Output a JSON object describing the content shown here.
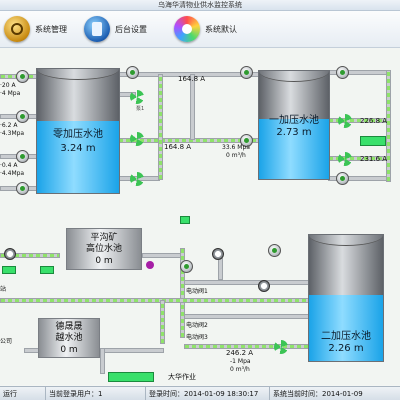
{
  "window": {
    "title": "乌海华清物业供水监控系统"
  },
  "toolbar": {
    "items": [
      {
        "label": "系统管理"
      },
      {
        "label": "后台设置"
      },
      {
        "label": "系统默认"
      }
    ]
  },
  "tanks": {
    "zero": {
      "name": "零加压水池",
      "value": "3.24 m"
    },
    "one": {
      "name": "一加压水池",
      "value": "2.73 m"
    },
    "two": {
      "name": "二加压水池",
      "value": "2.26 m"
    },
    "pinggou": {
      "name_line1": "平沟矿",
      "name_line2": "高位水池",
      "value": "0 m"
    },
    "desheng": {
      "name_line1": "德晟晟",
      "name_line2": "越水池",
      "value": "0 m"
    }
  },
  "readings": {
    "l1": "·20 A",
    "l2": "·4 Mpa",
    "l3": "·6.2 A",
    "l4": "·4.3Mpa",
    "l5": "·0.4 A",
    "l6": "·4.4Mpa",
    "c1": "164.8 A",
    "c2": "164.8 A",
    "c3": "33.6 Mpa",
    "c4": "0 m³/h",
    "r1": "226.8 A",
    "r2": "231.6 A",
    "b1": "246.2 A",
    "b2": "-1 Mpa",
    "b3": "0 m³/h",
    "m1": "电动阀1",
    "m2": "电动阀2",
    "m3": "电动阀3"
  },
  "labels": {
    "pump_small": "泵1",
    "left_edge_a": "公司",
    "left_edge_b": "站",
    "bottom_site": "大华作业"
  },
  "statusbar": {
    "running": "运行",
    "user_label": "当前登录用户：",
    "user_value": "1",
    "login_time_label": "登录时间：",
    "login_time_value": "2014-01-09 18:30:17",
    "sys_time_label": "系统当前时间：",
    "sys_time_value": "2014-01-09"
  },
  "colors": {
    "water": "#1aa3e8",
    "pipe_flow": "#8fe36a",
    "status_green": "#39e06b"
  }
}
